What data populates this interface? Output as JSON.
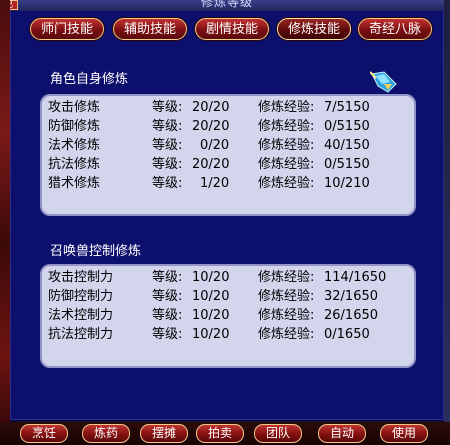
{
  "window": {
    "title": "修炼等级",
    "system_button": "己"
  },
  "tabs": [
    {
      "label": "师门技能",
      "active": false
    },
    {
      "label": "辅助技能",
      "active": false
    },
    {
      "label": "剧情技能",
      "active": false
    },
    {
      "label": "修炼技能",
      "active": true
    },
    {
      "label": "奇经八脉",
      "active": false
    }
  ],
  "role_section": {
    "title": "角色自身修炼",
    "rows": [
      {
        "name": "攻击修炼",
        "level_label": "等级:",
        "level": "20/20",
        "exp_label": "修炼经验:",
        "exp": "7/5150"
      },
      {
        "name": "防御修炼",
        "level_label": "等级:",
        "level": "20/20",
        "exp_label": "修炼经验:",
        "exp": "0/5150"
      },
      {
        "name": "法术修炼",
        "level_label": "等级:",
        "level": "0/20",
        "exp_label": "修炼经验:",
        "exp": "40/150"
      },
      {
        "name": "抗法修炼",
        "level_label": "等级:",
        "level": "20/20",
        "exp_label": "修炼经验:",
        "exp": "0/5150"
      },
      {
        "name": "猎术修炼",
        "level_label": "等级:",
        "level": "1/20",
        "exp_label": "修炼经验:",
        "exp": "10/210"
      }
    ]
  },
  "pet_section": {
    "title": "召唤兽控制修炼",
    "rows": [
      {
        "name": "攻击控制力",
        "level_label": "等级:",
        "level": "10/20",
        "exp_label": "修炼经验:",
        "exp": "114/1650"
      },
      {
        "name": "防御控制力",
        "level_label": "等级:",
        "level": "10/20",
        "exp_label": "修炼经验:",
        "exp": "32/1650"
      },
      {
        "name": "法术控制力",
        "level_label": "等级:",
        "level": "10/20",
        "exp_label": "修炼经验:",
        "exp": "26/1650"
      },
      {
        "name": "抗法控制力",
        "level_label": "等级:",
        "level": "10/20",
        "exp_label": "修炼经验:",
        "exp": "0/1650"
      }
    ]
  },
  "bottom_bar": [
    "烹饪",
    "炼药",
    "摆摊",
    "拍卖",
    "团队",
    "自动",
    "使用"
  ],
  "colors": {
    "window_bg": "#0d0f6d",
    "panel_bg": "#d2d5ec",
    "tab_red": "#7a0f12",
    "tab_border": "#f3d08c"
  },
  "icons": {
    "corner_gem": "blue-crystal-icon"
  }
}
